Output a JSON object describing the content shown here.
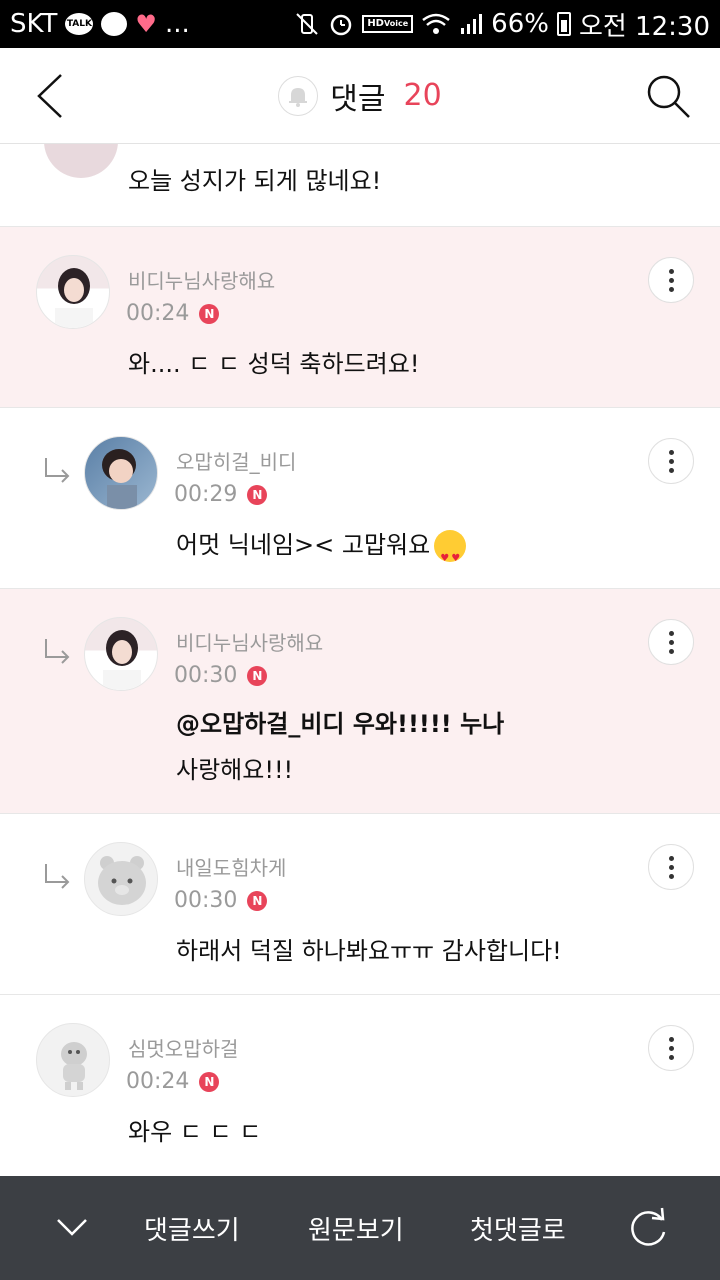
{
  "status_bar": {
    "carrier": "SKT",
    "talk_label": "TALK",
    "more": "...",
    "hd_label": "HD",
    "voice_label": "Voice",
    "battery": "66%",
    "time": "오전 12:30"
  },
  "header": {
    "title": "댓글",
    "count": "20"
  },
  "comments": [
    {
      "author": "",
      "time": "",
      "text": "오늘 성지가 되게 많네요!"
    },
    {
      "author": "비디누님사랑해요",
      "time": "00:24",
      "badge": "N",
      "text": "와.... ㄷ ㄷ 성덕 축하드려요!"
    },
    {
      "author": "오맙히걸_비디",
      "time": "00:29",
      "badge": "N",
      "text": "어멋 닉네임>< 고맙워요"
    },
    {
      "author": "비디누님사랑해요",
      "time": "00:30",
      "badge": "N",
      "text_line1": "@오맙하걸_비디 우와!!!!! 누나",
      "text_line2": "사랑해요!!!"
    },
    {
      "author": "내일도힘차게",
      "time": "00:30",
      "badge": "N",
      "text": "하래서 덕질 하나봐요ㅠㅠ 감사합니다!"
    },
    {
      "author": "심멋오맙하걸",
      "time": "00:24",
      "badge": "N",
      "text": "와우 ㄷ ㄷ ㄷ"
    }
  ],
  "bottom_bar": {
    "write": "댓글쓰기",
    "original": "원문보기",
    "first": "첫댓글로"
  }
}
